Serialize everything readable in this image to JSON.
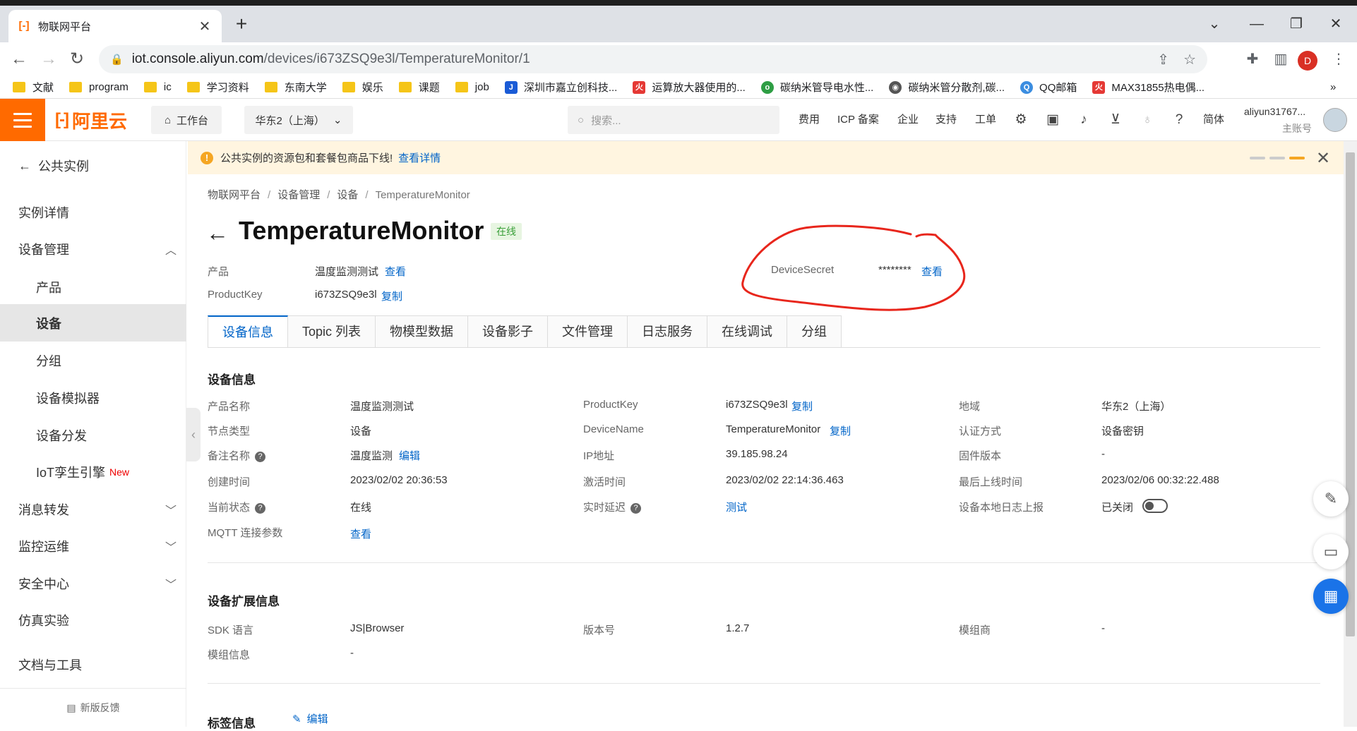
{
  "browser": {
    "tab_title": "物联网平台",
    "tab_close": "✕",
    "new_tab": "+",
    "url_main": "iot.console.aliyun.com",
    "url_rest": "/devices/i673ZSQ9e3l/TemperatureMonitor/1",
    "profile": "D",
    "bookmarks": [
      "文献",
      "program",
      "ic",
      "学习资料",
      "东南大学",
      "娱乐",
      "课题",
      "job",
      "深圳市嘉立创科技...",
      "运算放大器使用的...",
      "碳纳米管导电水性...",
      "碳纳米管分散剂,碳...",
      "QQ邮箱",
      "MAX31855热电偶..."
    ],
    "bm_more": "»"
  },
  "app": {
    "logo": "阿里云",
    "workbench": "工作台",
    "region": "华东2（上海）",
    "search_placeholder": "搜索...",
    "nav": [
      "费用",
      "ICP 备案",
      "企业",
      "支持",
      "工单"
    ],
    "lang": "简体",
    "account": "aliyun31767...",
    "account_type": "主账号"
  },
  "sidebar": {
    "back": "公共实例",
    "items": [
      "实例详情",
      "设备管理",
      "产品",
      "设备",
      "分组",
      "设备模拟器",
      "设备分发",
      "IoT孪生引擎",
      "消息转发",
      "监控运维",
      "安全中心",
      "仿真实验",
      "文档与工具"
    ],
    "new_badge": "New",
    "feedback": "新版反馈"
  },
  "notice": {
    "text": "公共实例的资源包和套餐包商品下线!",
    "link": "查看详情"
  },
  "breadcrumb": [
    "物联网平台",
    "设备管理",
    "设备",
    "TemperatureMonitor"
  ],
  "device": {
    "name": "TemperatureMonitor",
    "status": "在线",
    "product_label": "产品",
    "product_value": "温度监测测试",
    "view": "查看",
    "pk_label": "ProductKey",
    "pk_value": "i673ZSQ9e3l",
    "copy": "复制",
    "secret_label": "DeviceSecret",
    "secret_value": "********"
  },
  "tabs": [
    "设备信息",
    "Topic 列表",
    "物模型数据",
    "设备影子",
    "文件管理",
    "日志服务",
    "在线调试",
    "分组"
  ],
  "info": {
    "title": "设备信息",
    "c1": [
      [
        "产品名称",
        "温度监测测试"
      ],
      [
        "节点类型",
        "设备"
      ],
      [
        "备注名称",
        "温度监测"
      ],
      [
        "创建时间",
        "2023/02/02 20:36:53"
      ],
      [
        "当前状态",
        "在线"
      ],
      [
        "MQTT 连接参数",
        "查看"
      ]
    ],
    "c2": [
      [
        "ProductKey",
        "i673ZSQ9e3l"
      ],
      [
        "DeviceName",
        "TemperatureMonitor"
      ],
      [
        "IP地址",
        "39.185.98.24"
      ],
      [
        "激活时间",
        "2023/02/02 22:14:36.463"
      ],
      [
        "实时延迟",
        "测试"
      ]
    ],
    "c3": [
      [
        "地域",
        "华东2（上海）"
      ],
      [
        "认证方式",
        "设备密钥"
      ],
      [
        "固件版本",
        "-"
      ],
      [
        "最后上线时间",
        "2023/02/06 00:32:22.488"
      ],
      [
        "设备本地日志上报",
        "已关闭"
      ]
    ],
    "edit": "编辑",
    "copy": "复制"
  },
  "ext": {
    "title": "设备扩展信息",
    "sdk_label": "SDK 语言",
    "sdk_value": "JS|Browser",
    "ver_label": "版本号",
    "ver_value": "1.2.7",
    "mod_label": "模组商",
    "mod_value": "-",
    "modinfo_label": "模组信息",
    "modinfo_value": "-"
  },
  "tags": {
    "title": "标签信息",
    "edit": "编辑"
  },
  "colors": {
    "accent": "#ff6a00",
    "link": "#0064c8",
    "annotation": "#e8261c"
  }
}
